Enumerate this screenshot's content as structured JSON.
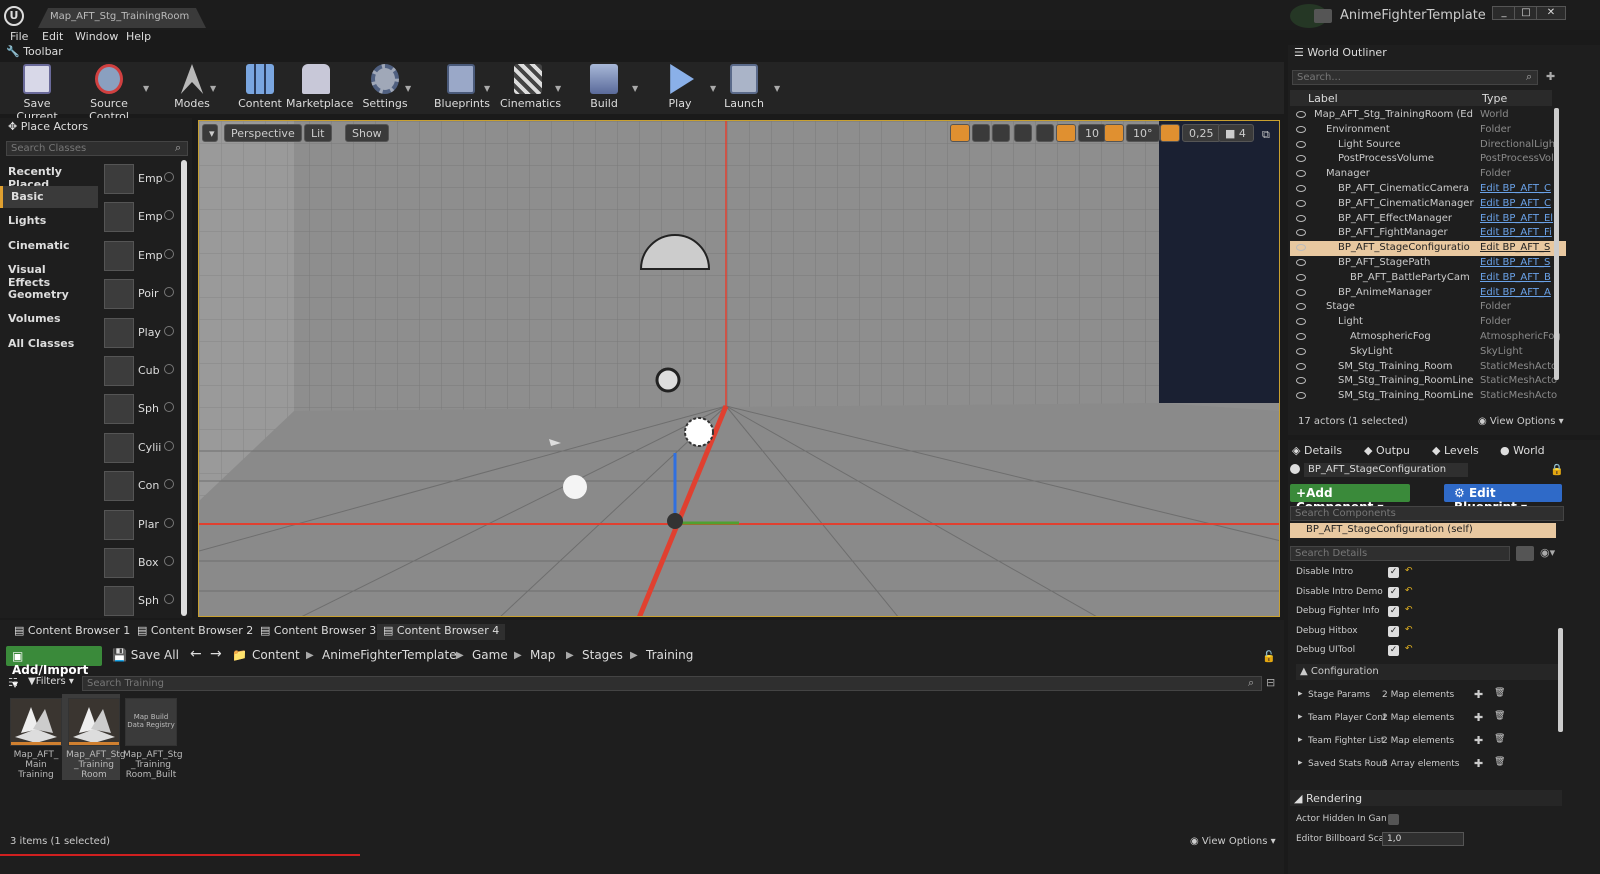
{
  "window": {
    "doc_tab": "Map_AFT_Stg_TrainingRoom",
    "project": "AnimeFighterTemplate",
    "minimize": "_",
    "maximize": "□",
    "close": "✕"
  },
  "menu": [
    "File",
    "Edit",
    "Window",
    "Help"
  ],
  "toolbar": {
    "tab": "Toolbar",
    "buttons": [
      "Save Current",
      "Source Control",
      "Modes",
      "Content",
      "Marketplace",
      "Settings",
      "Blueprints",
      "Cinematics",
      "Build",
      "Play",
      "Launch"
    ]
  },
  "place_actors": {
    "tab": "Place Actors",
    "search_placeholder": "Search Classes",
    "categories": [
      "Recently Placed",
      "Basic",
      "Lights",
      "Cinematic",
      "Visual Effects",
      "Geometry",
      "Volumes",
      "All Classes"
    ],
    "items": [
      "Emp",
      "Emp",
      "Emp",
      "Poir",
      "Play",
      "Cub",
      "Sph",
      "Cylii",
      "Con",
      "Plar",
      "Box",
      "Sph"
    ]
  },
  "viewport": {
    "menu_arrow": "▾",
    "perspective": "Perspective",
    "lit": "Lit",
    "show": "Show",
    "grid": "10",
    "rot": "10°",
    "scale": "0,25",
    "cam": "4"
  },
  "outliner": {
    "tab": "World Outliner",
    "search_placeholder": "Search...",
    "col_label": "Label",
    "col_type": "Type",
    "rows": [
      {
        "label": "Map_AFT_Stg_TrainingRoom (Ed",
        "type": "World",
        "link": false,
        "indent": 0
      },
      {
        "label": "Environment",
        "type": "Folder",
        "link": false,
        "indent": 1
      },
      {
        "label": "Light Source",
        "type": "DirectionalLight",
        "link": false,
        "indent": 2
      },
      {
        "label": "PostProcessVolume",
        "type": "PostProcessVol",
        "link": false,
        "indent": 2
      },
      {
        "label": "Manager",
        "type": "Folder",
        "link": false,
        "indent": 1
      },
      {
        "label": "BP_AFT_CinematicCamera",
        "type": "Edit BP_AFT_C",
        "link": true,
        "indent": 2
      },
      {
        "label": "BP_AFT_CinematicManager",
        "type": "Edit BP_AFT_C",
        "link": true,
        "indent": 2
      },
      {
        "label": "BP_AFT_EffectManager",
        "type": "Edit BP_AFT_El",
        "link": true,
        "indent": 2
      },
      {
        "label": "BP_AFT_FightManager",
        "type": "Edit BP_AFT_Fi",
        "link": true,
        "indent": 2
      },
      {
        "label": "BP_AFT_StageConfiguratio",
        "type": "Edit BP_AFT_S",
        "link": true,
        "indent": 2,
        "selected": true
      },
      {
        "label": "BP_AFT_StagePath",
        "type": "Edit BP_AFT_S",
        "link": true,
        "indent": 2
      },
      {
        "label": "BP_AFT_BattlePartyCam",
        "type": "Edit BP_AFT_B",
        "link": true,
        "indent": 3
      },
      {
        "label": "BP_AnimeManager",
        "type": "Edit BP_AFT_A",
        "link": true,
        "indent": 2
      },
      {
        "label": "Stage",
        "type": "Folder",
        "link": false,
        "indent": 1
      },
      {
        "label": "Light",
        "type": "Folder",
        "link": false,
        "indent": 2
      },
      {
        "label": "AtmosphericFog",
        "type": "AtmosphericFog",
        "link": false,
        "indent": 3
      },
      {
        "label": "SkyLight",
        "type": "SkyLight",
        "link": false,
        "indent": 3
      },
      {
        "label": "SM_Stg_Training_Room",
        "type": "StaticMeshActo",
        "link": false,
        "indent": 2
      },
      {
        "label": "SM_Stg_Training_RoomLine",
        "type": "StaticMeshActo",
        "link": false,
        "indent": 2
      },
      {
        "label": "SM_Stg_Training_RoomLine",
        "type": "StaticMeshActo",
        "link": false,
        "indent": 2
      }
    ],
    "footer": "17 actors (1 selected)",
    "view_options": "View Options"
  },
  "details": {
    "tabs": [
      "Details",
      "Outpu",
      "Levels",
      "World"
    ],
    "name": "BP_AFT_StageConfiguration",
    "add_component": "Add Component",
    "edit_blueprint": "Edit Blueprint",
    "search_components": "Search Components",
    "self": "BP_AFT_StageConfiguration (self)",
    "search_details": "Search Details",
    "bools": [
      "Disable Intro",
      "Disable Intro Demo",
      "Debug Fighter Info",
      "Debug Hitbox",
      "Debug UITool"
    ],
    "config": "Configuration",
    "props": [
      {
        "name": "Stage Params",
        "value": "2 Map elements"
      },
      {
        "name": "Team Player Cont",
        "value": "2 Map elements"
      },
      {
        "name": "Team Fighter List",
        "value": "2 Map elements"
      },
      {
        "name": "Saved Stats Roun",
        "value": "3 Array elements"
      }
    ],
    "rendering": "Rendering",
    "hidden": "Actor Hidden In Gan",
    "billboard": "Editor Billboard Sca",
    "billboard_val": "1,0"
  },
  "content_browser": {
    "tabs": [
      "Content Browser 1",
      "Content Browser 2",
      "Content Browser 3",
      "Content Browser 4"
    ],
    "add_import": "Add/Import",
    "save_all": "Save All",
    "path": [
      "Content",
      "AnimeFighterTemplate",
      "Game",
      "Map",
      "Stages",
      "Training"
    ],
    "filters": "Filters",
    "search_placeholder": "Search Training",
    "assets": [
      [
        "Map_AFT_",
        "Main",
        "Training"
      ],
      [
        "Map_AFT_Stg",
        "_Training",
        "Room"
      ],
      [
        "Map_AFT_Stg",
        "_Training",
        "Room_Built"
      ]
    ],
    "registry": [
      "Map Build",
      "Data Registry"
    ],
    "footer": "3 items (1 selected)",
    "view_options": "View Options"
  }
}
